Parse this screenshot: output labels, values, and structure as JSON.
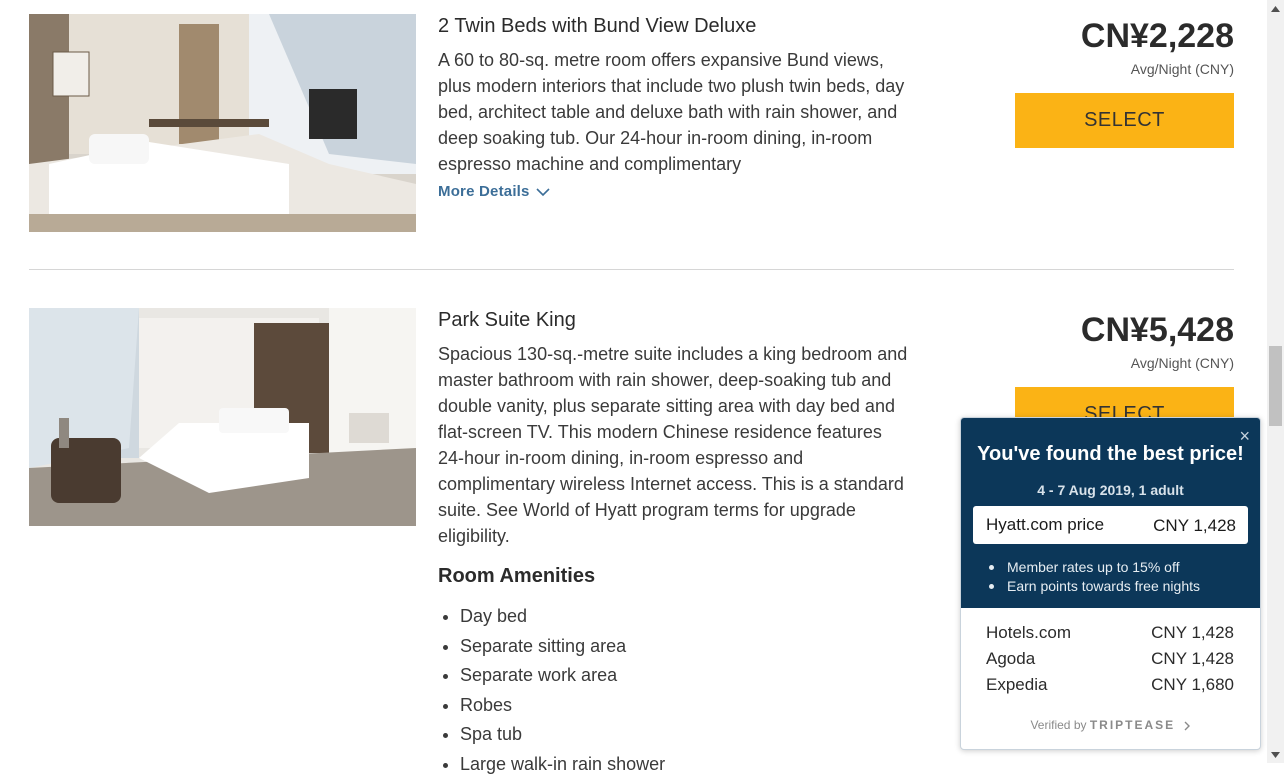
{
  "rooms": [
    {
      "title": "2 Twin Beds with Bund View Deluxe",
      "description": "A 60 to 80-sq. metre room offers expansive Bund views, plus modern interiors that include two plush twin beds, day bed, architect table and deluxe bath with rain shower, and deep soaking tub. Our 24-hour in-room dining, in-room espresso machine and complimentary",
      "more_details": "More Details",
      "price": "CN¥2,228",
      "per_night": "Avg/Night (CNY)",
      "select_label": "SELECT"
    },
    {
      "title": "Park Suite King",
      "description": "Spacious 130-sq.-metre suite includes a king bedroom and master bathroom with rain shower, deep-soaking tub and double vanity, plus separate sitting area with day bed and flat-screen TV. This modern Chinese residence features 24-hour in-room dining, in-room espresso and complimentary wireless Internet access. This is a standard suite. See World of Hyatt program terms for upgrade eligibility.",
      "price": "CN¥5,428",
      "per_night": "Avg/Night (CNY)",
      "select_label": "SELECT",
      "amenities_title": "Room Amenities",
      "amenities": [
        "Day bed",
        "Separate sitting area",
        "Separate work area",
        "Robes",
        "Spa tub",
        "Large walk-in rain shower"
      ]
    }
  ],
  "popup": {
    "close": "×",
    "headline": "You've found the best price!",
    "dates": "4 - 7 Aug 2019, 1 adult",
    "hyatt_label": "Hyatt.com price",
    "hyatt_price": "CNY 1,428",
    "perks": [
      "Member rates up to 15% off",
      "Earn points towards free nights"
    ],
    "competitors": [
      {
        "name": "Hotels.com",
        "price": "CNY 1,428"
      },
      {
        "name": "Agoda",
        "price": "CNY 1,428"
      },
      {
        "name": "Expedia",
        "price": "CNY 1,680"
      }
    ],
    "verified_prefix": "Verified by",
    "verified_brand": "TRIPTEASE"
  },
  "colors": {
    "select_button": "#fbb315",
    "popup_navy": "#0c3759",
    "link_blue": "#3c6e98"
  }
}
